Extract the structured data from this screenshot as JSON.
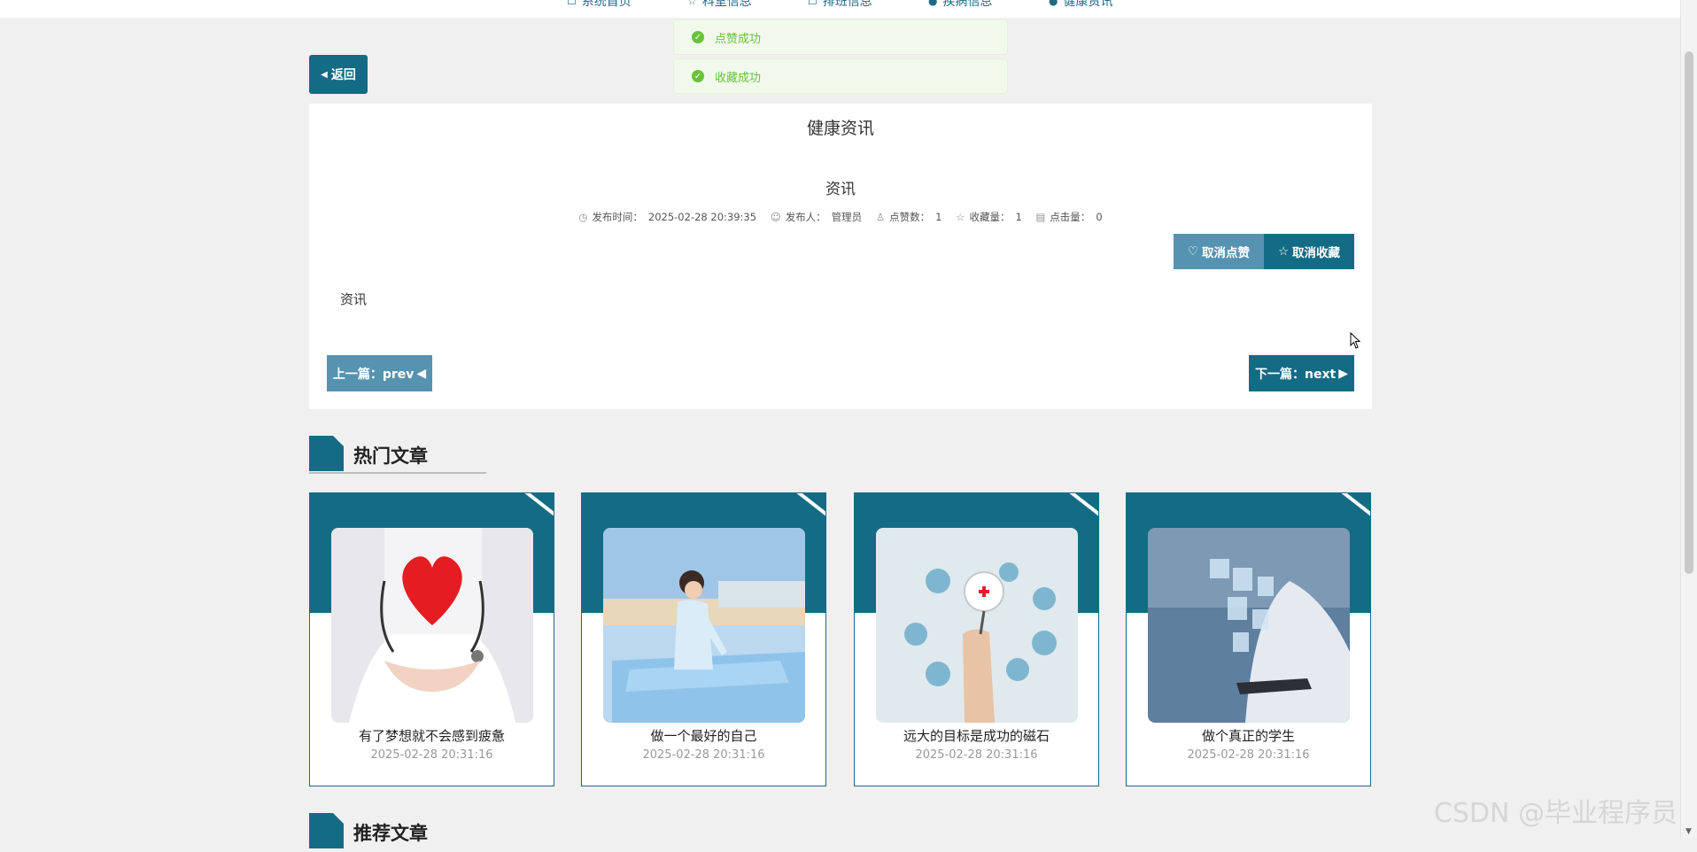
{
  "nav": {
    "items": [
      {
        "label": "系统首页",
        "icon": "home-icon"
      },
      {
        "label": "科室信息",
        "icon": "star-icon"
      },
      {
        "label": "排班信息",
        "icon": "calendar-icon"
      },
      {
        "label": "疾病信息",
        "icon": "check-circle-icon"
      },
      {
        "label": "健康资讯",
        "icon": "check-circle-icon"
      }
    ]
  },
  "toasts": [
    {
      "text": "点赞成功",
      "icon": "success-icon"
    },
    {
      "text": "收藏成功",
      "icon": "success-icon"
    }
  ],
  "back_button": "返回",
  "detail": {
    "section_title": "健康资讯",
    "article_title": "资讯",
    "meta": {
      "publish_time_label": "发布时间：",
      "publish_time": "2025-02-28 20:39:35",
      "publisher_label": "发布人：",
      "publisher": "管理员",
      "likes_label": "点赞数：",
      "likes": "1",
      "favorites_label": "收藏量：",
      "favorites": "1",
      "clicks_label": "点击量：",
      "clicks": "0"
    },
    "unlike_button": "取消点赞",
    "unfavorite_button": "取消收藏",
    "content": "资讯",
    "prev_button": "上一篇：prev",
    "next_button": "下一篇：next"
  },
  "hot_articles": {
    "heading": "热门文章",
    "items": [
      {
        "title": "有了梦想就不会感到疲惫",
        "date": "2025-02-28 20:31:16"
      },
      {
        "title": "做一个最好的自己",
        "date": "2025-02-28 20:31:16"
      },
      {
        "title": "远大的目标是成功的磁石",
        "date": "2025-02-28 20:31:16"
      },
      {
        "title": "做个真正的学生",
        "date": "2025-02-28 20:31:16"
      }
    ]
  },
  "recommended": {
    "heading": "推荐文章"
  },
  "watermark": "CSDN @毕业程序员",
  "colors": {
    "primary": "#146b84",
    "secondary": "#5693b1",
    "success": "#67c23a",
    "background": "#f0f0f0"
  }
}
